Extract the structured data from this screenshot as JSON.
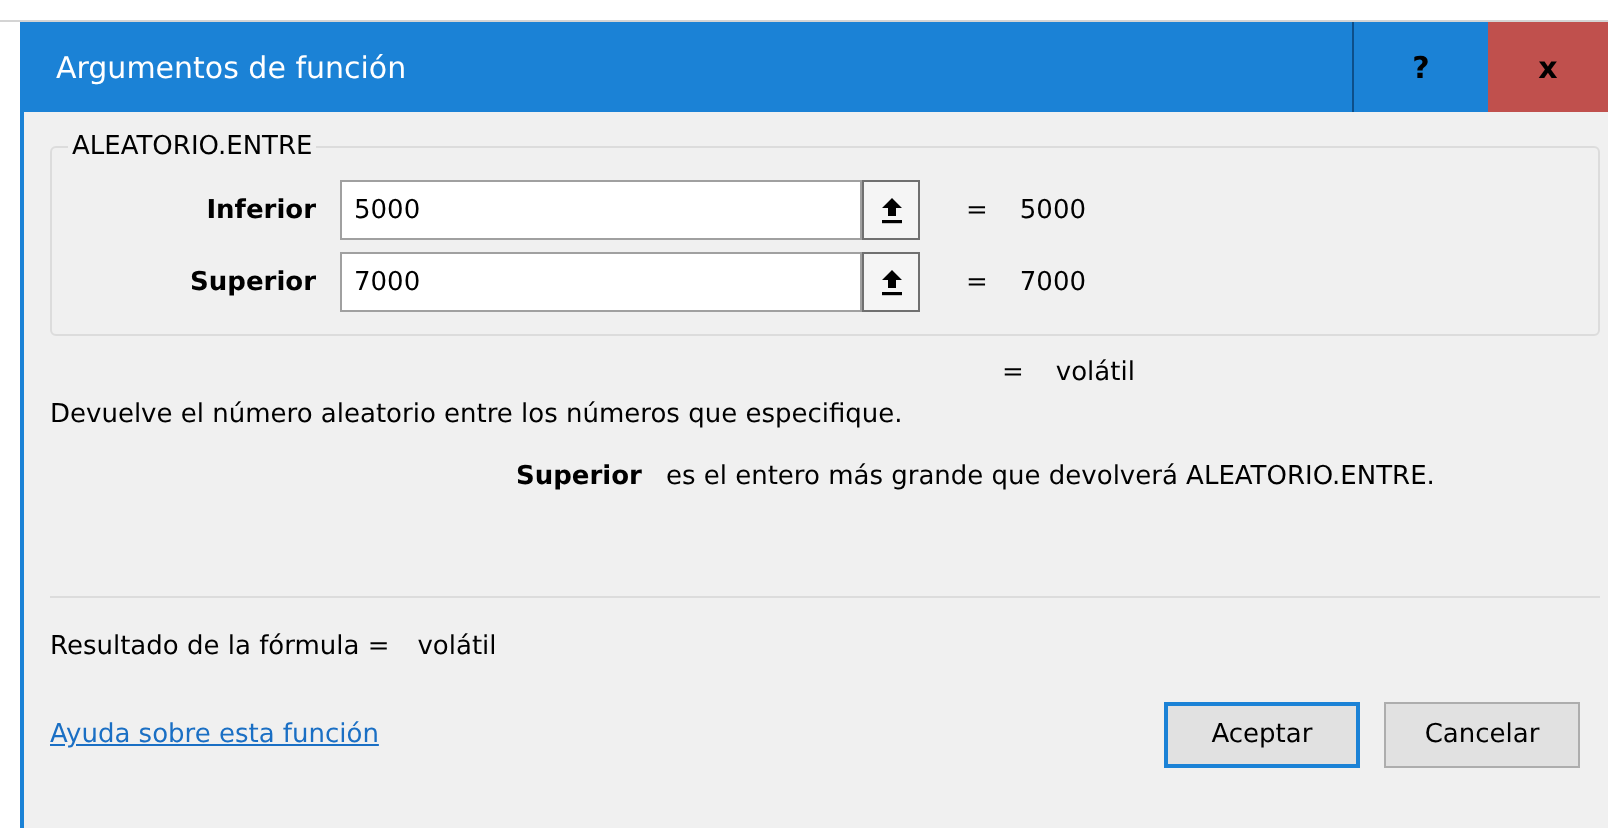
{
  "window": {
    "title": "Argumentos de función",
    "help": "?",
    "close": "x"
  },
  "function": {
    "name": "ALEATORIO.ENTRE",
    "arguments": [
      {
        "label": "Inferior",
        "value": "5000",
        "sign": "=",
        "result": "5000"
      },
      {
        "label": "Superior",
        "value": "7000",
        "sign": "=",
        "result": "7000"
      }
    ],
    "sign": "=",
    "result": "volátil"
  },
  "description": "Devuelve el número aleatorio entre los números que especifique.",
  "argument_help": {
    "name": "Superior",
    "text": "es el entero más grande que devolverá ALEATORIO.ENTRE."
  },
  "formula_result": {
    "label": "Resultado de la fórmula =",
    "value": "volátil"
  },
  "help_link": "Ayuda sobre esta función",
  "buttons": [
    {
      "label": "Aceptar",
      "default": true
    },
    {
      "label": "Cancelar",
      "default": false
    }
  ]
}
